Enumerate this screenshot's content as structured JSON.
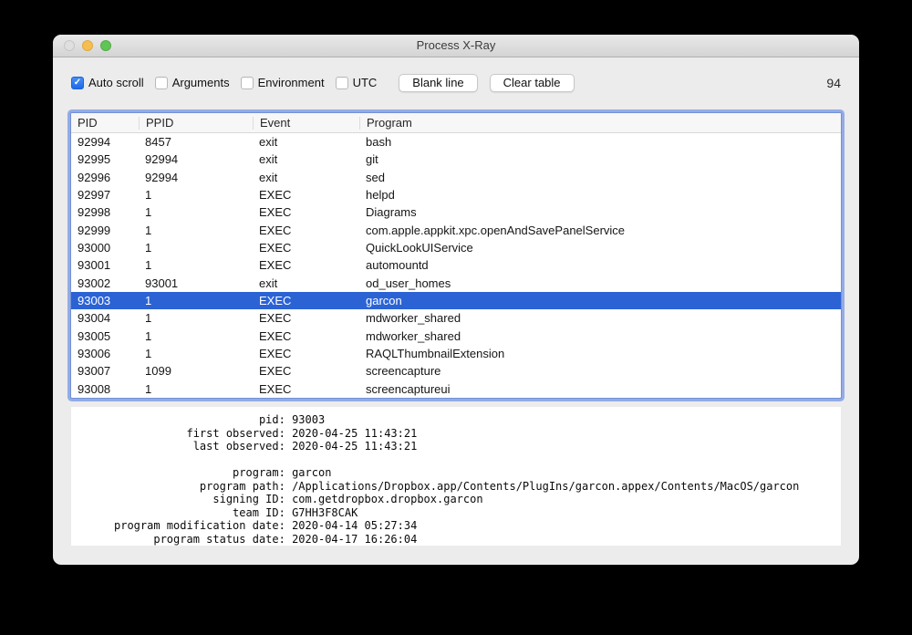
{
  "window": {
    "title": "Process X-Ray"
  },
  "toolbar": {
    "checkboxes": [
      {
        "label": "Auto scroll",
        "checked": true
      },
      {
        "label": "Arguments",
        "checked": false
      },
      {
        "label": "Environment",
        "checked": false
      },
      {
        "label": "UTC",
        "checked": false
      }
    ],
    "buttons": [
      {
        "label": "Blank line"
      },
      {
        "label": "Clear table"
      }
    ],
    "event_count": "94"
  },
  "table": {
    "columns": [
      "PID",
      "PPID",
      "Event",
      "Program"
    ],
    "selected_index": 9,
    "rows": [
      {
        "pid": "92994",
        "ppid": "8457",
        "event": "exit",
        "program": "bash"
      },
      {
        "pid": "92995",
        "ppid": "92994",
        "event": "exit",
        "program": "git"
      },
      {
        "pid": "92996",
        "ppid": "92994",
        "event": "exit",
        "program": "sed"
      },
      {
        "pid": "92997",
        "ppid": "1",
        "event": "EXEC",
        "program": "helpd"
      },
      {
        "pid": "92998",
        "ppid": "1",
        "event": "EXEC",
        "program": "Diagrams"
      },
      {
        "pid": "92999",
        "ppid": "1",
        "event": "EXEC",
        "program": "com.apple.appkit.xpc.openAndSavePanelService"
      },
      {
        "pid": "93000",
        "ppid": "1",
        "event": "EXEC",
        "program": "QuickLookUIService"
      },
      {
        "pid": "93001",
        "ppid": "1",
        "event": "EXEC",
        "program": "automountd"
      },
      {
        "pid": "93002",
        "ppid": "93001",
        "event": "exit",
        "program": "od_user_homes"
      },
      {
        "pid": "93003",
        "ppid": "1",
        "event": "EXEC",
        "program": "garcon"
      },
      {
        "pid": "93004",
        "ppid": "1",
        "event": "EXEC",
        "program": "mdworker_shared"
      },
      {
        "pid": "93005",
        "ppid": "1",
        "event": "EXEC",
        "program": "mdworker_shared"
      },
      {
        "pid": "93006",
        "ppid": "1",
        "event": "EXEC",
        "program": "RAQLThumbnailExtension"
      },
      {
        "pid": "93007",
        "ppid": "1099",
        "event": "EXEC",
        "program": "screencapture"
      },
      {
        "pid": "93008",
        "ppid": "1",
        "event": "EXEC",
        "program": "screencaptureui"
      }
    ]
  },
  "details": {
    "label_pad": 25,
    "lines": [
      {
        "label": "pid",
        "value": "93003"
      },
      {
        "label": "first observed",
        "value": "2020-04-25 11:43:21"
      },
      {
        "label": "last observed",
        "value": "2020-04-25 11:43:21"
      },
      {
        "blank": true
      },
      {
        "label": "program",
        "value": "garcon"
      },
      {
        "label": "program path",
        "value": "/Applications/Dropbox.app/Contents/PlugIns/garcon.appex/Contents/MacOS/garcon"
      },
      {
        "label": "signing ID",
        "value": "com.getdropbox.dropbox.garcon"
      },
      {
        "label": "team ID",
        "value": "G7HH3F8CAK"
      },
      {
        "label": "program modification date",
        "value": "2020-04-14 05:27:34"
      },
      {
        "label": "program status date",
        "value": "2020-04-17 16:26:04"
      }
    ]
  },
  "colors": {
    "selection_blue": "#2B63D5",
    "checkbox_blue": "#1D6AE9",
    "focus_ring": "#93ABE5"
  }
}
